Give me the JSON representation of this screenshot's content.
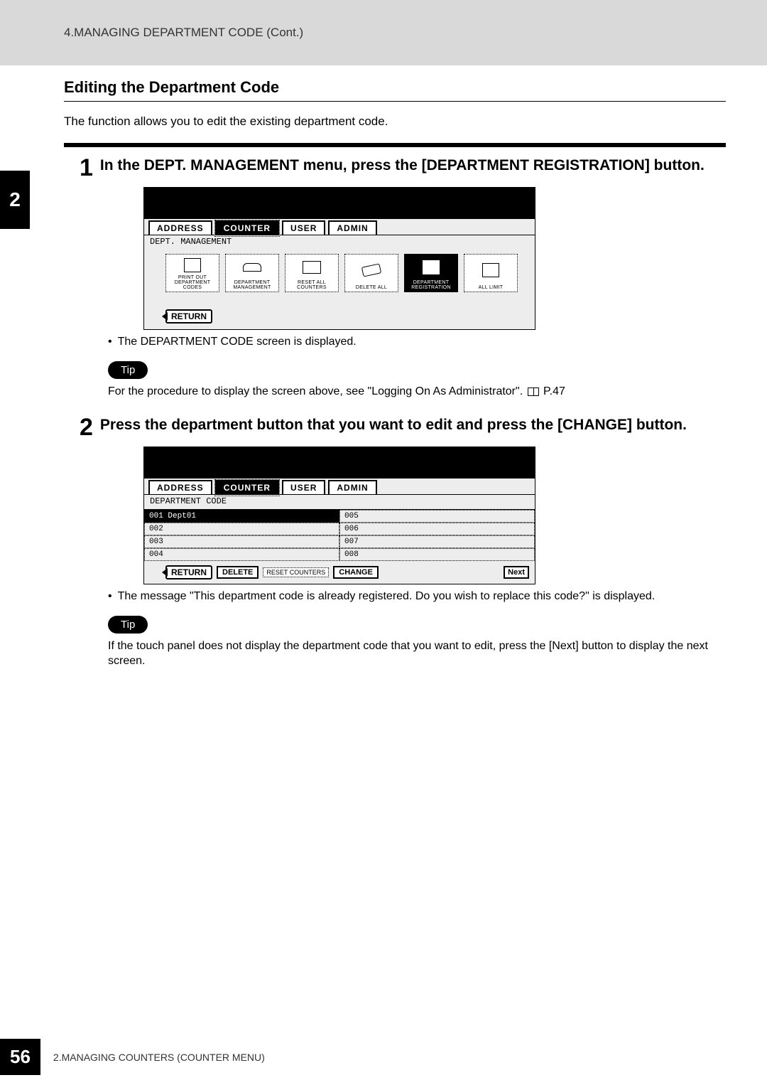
{
  "header": "4.MANAGING DEPARTMENT CODE (Cont.)",
  "section_title": "Editing the Department Code",
  "intro": "The function allows you to edit the existing department code.",
  "chapter_tab": "2",
  "step1": {
    "num": "1",
    "text": "In the DEPT. MANAGEMENT menu, press the [DEPARTMENT REGISTRATION] button.",
    "bullet": "The DEPARTMENT CODE screen is displayed.",
    "tip_label": "Tip",
    "tip_text_a": "For the procedure to display the screen above, see \"Logging On As Administrator\".",
    "tip_text_b": "P.47"
  },
  "step2": {
    "num": "2",
    "text": "Press the department button that you want to edit and press the [CHANGE] button.",
    "bullet": "The message \"This department code is already registered.  Do you wish to replace this code?\" is displayed.",
    "tip_label": "Tip",
    "tip_text": "If the touch panel does not display the department code that you want to edit, press the [Next] button to display the next screen."
  },
  "screenshot1": {
    "tabs": [
      "ADDRESS",
      "COUNTER",
      "USER",
      "ADMIN"
    ],
    "subtitle": "DEPT. MANAGEMENT",
    "icons": [
      {
        "label": "PRINT OUT\nDEPARTMENT CODES"
      },
      {
        "label": "DEPARTMENT\nMANAGEMENT"
      },
      {
        "label": "RESET\nALL COUNTERS"
      },
      {
        "label": "DELETE ALL"
      },
      {
        "label": "DEPARTMENT\nREGISTRATION"
      },
      {
        "label": "ALL LIMIT"
      }
    ],
    "return": "RETURN"
  },
  "screenshot2": {
    "tabs": [
      "ADDRESS",
      "COUNTER",
      "USER",
      "ADMIN"
    ],
    "subtitle": "DEPARTMENT CODE",
    "col1": [
      "001 Dept01",
      "002",
      "003",
      "004"
    ],
    "col2": [
      "005",
      "006",
      "007",
      "008"
    ],
    "return": "RETURN",
    "delete": "DELETE",
    "reset": "RESET COUNTERS",
    "change": "CHANGE",
    "next": "Next"
  },
  "footer": {
    "page": "56",
    "text": "2.MANAGING COUNTERS (COUNTER MENU)"
  }
}
